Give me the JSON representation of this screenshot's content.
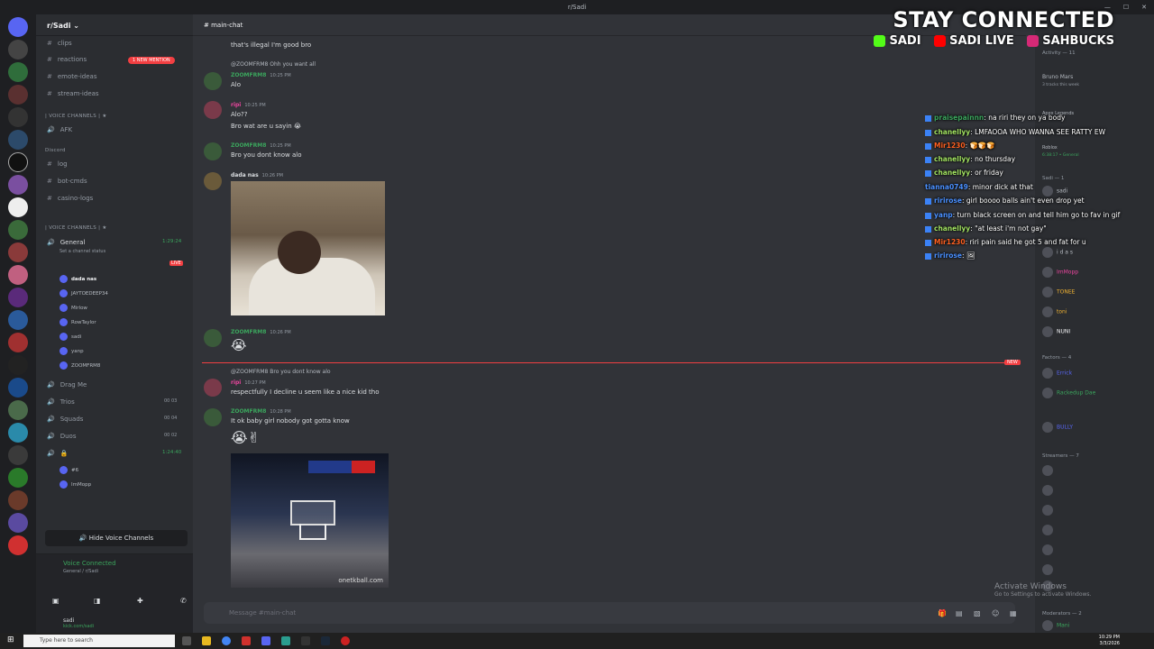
{
  "window": {
    "title": "r/Sadi"
  },
  "server": {
    "name": "r/Sadi"
  },
  "channels": [
    {
      "id": "clips",
      "label": "clips"
    },
    {
      "id": "reactions",
      "label": "reactions"
    },
    {
      "id": "emote-ideas",
      "label": "emote-ideas"
    },
    {
      "id": "stream-ideas",
      "label": "stream-ideas"
    }
  ],
  "mention_badge": "1 NEW MENTION",
  "voice_cat_1": "| VOICE CHANNELS | ★",
  "afk": "AFK",
  "discord_cat": "Discord",
  "text2": {
    "log": "log",
    "bot": "bot-cmds",
    "casino": "casino-logs"
  },
  "voice_cat_2": "| VOICE CHANNELS | ★",
  "voice": {
    "general": "General",
    "general_time": "1:29:24",
    "status": "Set a channel status",
    "live": "LIVE",
    "users": [
      "dada nas",
      "JAYTOEDEEP34",
      "Mirlow",
      "RowTaylor",
      "sadi",
      "yanp",
      "ZOOMFRM8"
    ],
    "drag": "Drag Me",
    "trios": "Trios",
    "squads": "Squads",
    "duos": "Duos",
    "t_trios": "00 03",
    "t_squads": "00 04",
    "t_duos": "00 02",
    "lock_time": "1:24:40",
    "lock_users": [
      "#6",
      "ImMopp"
    ]
  },
  "hide_voice": "Hide Voice Channels",
  "voice_connected": {
    "title": "Voice Connected",
    "sub": "General / r/Sadi"
  },
  "user": {
    "name": "sadi",
    "sub": "kick.com/sadi"
  },
  "main": {
    "channel": "main-chat",
    "messages": [
      {
        "text": "that's illegal I'm good bro"
      },
      {
        "reply": "@ZOOMFRM8 Ohh you want all",
        "name": "ZOOMFRM8",
        "time": "10:25 PM",
        "text": "Alo"
      },
      {
        "name": "ripi",
        "time": "10:25 PM",
        "text": "Alo??"
      },
      {
        "text": "Bro wat are u sayin 😭"
      },
      {
        "name": "ZOOMFRM8",
        "time": "10:25 PM",
        "text": "Bro you dont know alo"
      },
      {
        "name": "dada nas",
        "time": "10:26 PM"
      },
      {
        "name": "ZOOMFRM8",
        "time": "10:26 PM",
        "text": "😭"
      },
      {
        "reply": "@ZOOMFRM8 Bro you dont know alo",
        "name": "ripi",
        "time": "10:27 PM",
        "text": "respectfully I decline u seem like a nice kid tho"
      },
      {
        "name": "ZOOMFRM8",
        "time": "10:28 PM",
        "text": "It ok baby girl nobody got gotta know"
      },
      {
        "text": "😭✌"
      }
    ],
    "new_tag": "NEW",
    "gif_watermark": "onetkball.com",
    "composer": "Message #main-chat"
  },
  "overlay": {
    "title": "STAY CONNECTED",
    "kick": "SADI",
    "youtube": "SADI LIVE",
    "instagram": "SAHBUCKS"
  },
  "twitch_chat": [
    {
      "user": "praisepainnn",
      "text": ": na riri they on ya body"
    },
    {
      "user": "chanellyy",
      "text": ": LMFAOOA WHO WANNA SEE RATTY EW"
    },
    {
      "user": "Mir1230",
      "text": ": 🍞🍞🍞"
    },
    {
      "user": "chanellyy",
      "text": ": no thursday"
    },
    {
      "user": "chanellyy",
      "text": ": or friday"
    },
    {
      "user": "tianna0749",
      "text": ": minor dick at that"
    },
    {
      "user": "ririrose",
      "text": ": girl boooo balls ain't even drop yet"
    },
    {
      "user": "yanp",
      "text": ": turn black screen on and tell him go to fav in gif"
    },
    {
      "user": "chanellyy",
      "text": ": \"at least i'm not gay\""
    },
    {
      "user": "Mir1230",
      "text": ": riri pain said he got 5 and fat for u"
    },
    {
      "user": "ririrose",
      "text": ": 🖼"
    }
  ],
  "members": {
    "activity": "Activity — 11",
    "bruno": "Bruno Mars",
    "bruno_sub": "3 tracks this week",
    "legends": "Apex Legends",
    "roblox": "Roblox",
    "roblox_sub": "6:38:17 • General",
    "sadi_h": "Sadi — 1",
    "sadi": "sadi",
    "list": [
      "i d a s",
      "ImMopp",
      "TONEE",
      "toni",
      "NUNI"
    ],
    "factors_h": "Factors — 4",
    "factors": [
      "Errick",
      "Rackedup Dae",
      "BULLY"
    ],
    "streamers_h": "Streamers — 7",
    "moderators_h": "Moderators — 2",
    "mod": "Mani"
  },
  "watermark": {
    "title": "Activate Windows",
    "sub": "Go to Settings to activate Windows."
  },
  "taskbar": {
    "search": "Type here to search",
    "time": "10:29 PM",
    "date": "3/3/2026"
  }
}
